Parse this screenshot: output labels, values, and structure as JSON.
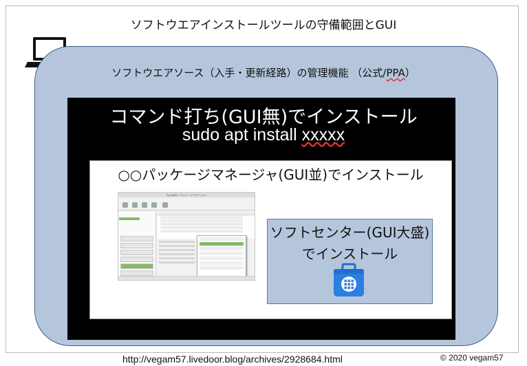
{
  "title": "ソフトウエアインストールツールの守備範囲とGUI",
  "sources": {
    "label_main": "ソフトウエアソース（入手・更新経路）の管理機能 （公式/",
    "label_ppa": "PPA",
    "label_end": "）"
  },
  "command_install": {
    "title": "コマンド打ち(GUI無)でインストール",
    "command_prefix": "sudo apt install ",
    "command_arg": "xxxxx"
  },
  "package_manager": {
    "title": "○○パッケージマネージャ(GUI並)でインストール",
    "screenshot_title": "Synaptic パッケージマネージャ"
  },
  "software_center": {
    "line1": "ソフトセンター(GUI大盛)",
    "line2": "でインストール"
  },
  "footer": {
    "url": "http://vegam57.livedoor.blog/archives/2928684.html",
    "copyright": "© 2020 vegam57"
  },
  "icons": {
    "laptop": "laptop-icon",
    "software_center": "software-center-bag-icon"
  },
  "colors": {
    "cloud_fill": "#b5c6dc",
    "cloud_border": "#3d5f8c",
    "command_box": "#000000",
    "icon_blue": "#2b7fe0"
  }
}
